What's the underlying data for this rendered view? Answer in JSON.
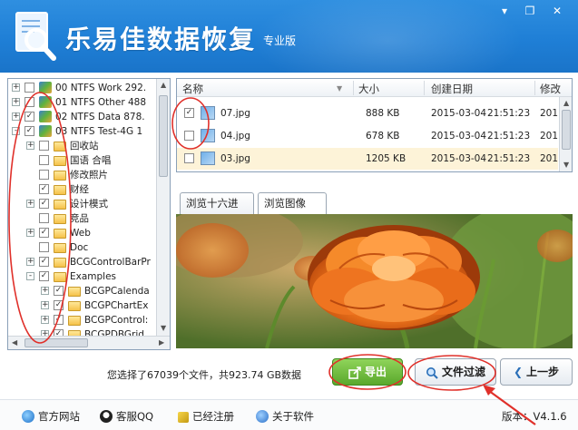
{
  "window": {
    "title": "乐易佳数据恢复",
    "edition": "专业版",
    "controls": {
      "minimize": "▾",
      "restore": "❐",
      "close": "✕"
    }
  },
  "tree": {
    "items": [
      {
        "level": 0,
        "expander": "+",
        "checked": false,
        "icon": "drive-icon",
        "label": "00  NTFS  Work  292."
      },
      {
        "level": 0,
        "expander": "+",
        "checked": false,
        "icon": "drive-icon",
        "label": "01  NTFS  Other  488"
      },
      {
        "level": 0,
        "expander": "+",
        "checked": true,
        "icon": "drive-icon",
        "label": "02  NTFS  Data  878."
      },
      {
        "level": 0,
        "expander": "-",
        "checked": true,
        "icon": "drive-icon",
        "label": "03  NTFS  Test-4G  1"
      },
      {
        "level": 1,
        "expander": "+",
        "checked": false,
        "icon": "folder-icon",
        "label": "回收站"
      },
      {
        "level": 1,
        "expander": "",
        "checked": false,
        "icon": "folder-icon",
        "label": "国语 合唱"
      },
      {
        "level": 1,
        "expander": "",
        "checked": false,
        "icon": "folder-icon",
        "label": "修改照片"
      },
      {
        "level": 1,
        "expander": "",
        "checked": true,
        "icon": "folder-icon",
        "label": "财经"
      },
      {
        "level": 1,
        "expander": "+",
        "checked": true,
        "icon": "folder-icon",
        "label": "设计模式"
      },
      {
        "level": 1,
        "expander": "",
        "checked": false,
        "icon": "folder-icon",
        "label": "竞品"
      },
      {
        "level": 1,
        "expander": "+",
        "checked": true,
        "icon": "folder-icon",
        "label": "Web"
      },
      {
        "level": 1,
        "expander": "",
        "checked": false,
        "icon": "folder-icon",
        "label": "Doc"
      },
      {
        "level": 1,
        "expander": "+",
        "checked": true,
        "icon": "folder-icon",
        "label": "BCGControlBarPr"
      },
      {
        "level": 1,
        "expander": "-",
        "checked": true,
        "icon": "folder-icon",
        "label": "Examples"
      },
      {
        "level": 2,
        "expander": "+",
        "checked": true,
        "icon": "folder-icon",
        "label": "BCGPCalenda"
      },
      {
        "level": 2,
        "expander": "+",
        "checked": true,
        "icon": "folder-icon",
        "label": "BCGPChartEx"
      },
      {
        "level": 2,
        "expander": "+",
        "checked": true,
        "icon": "folder-icon",
        "label": "BCGPControl:"
      },
      {
        "level": 2,
        "expander": "+",
        "checked": true,
        "icon": "folder-icon",
        "label": "BCGPDBGrid"
      }
    ]
  },
  "file_list": {
    "columns": [
      "名称",
      "大小",
      "创建日期",
      "修改"
    ],
    "rows": [
      {
        "name": "07.jpg",
        "size": "888 KB",
        "date": "2015-03-04",
        "time": "21:51:23",
        "mod": "201",
        "checked": true,
        "selected": false
      },
      {
        "name": "04.jpg",
        "size": "678 KB",
        "date": "2015-03-04",
        "time": "21:51:23",
        "mod": "201",
        "checked": false,
        "selected": false
      },
      {
        "name": "03.jpg",
        "size": "1205 KB",
        "date": "2015-03-04",
        "time": "21:51:23",
        "mod": "201",
        "checked": false,
        "selected": true
      }
    ]
  },
  "preview": {
    "tabs": [
      "浏览十六进制",
      "浏览图像"
    ],
    "active_tab": "浏览图像",
    "image_subject": "orange-flower-photo"
  },
  "status": {
    "text": "您选择了67039个文件，共923.74 GB数据"
  },
  "buttons": {
    "export": "导出",
    "filter": "文件过滤",
    "prev": "上一步"
  },
  "footer": {
    "links": [
      "官方网站",
      "客服QQ",
      "已经注册",
      "关于软件"
    ],
    "version_label": "版本：",
    "version": "V4.1.6"
  },
  "colors": {
    "header": "#1f7fd6",
    "export_button": "#5aa82c",
    "selected_row": "#fdf3d8",
    "annotation": "#e0302a"
  }
}
